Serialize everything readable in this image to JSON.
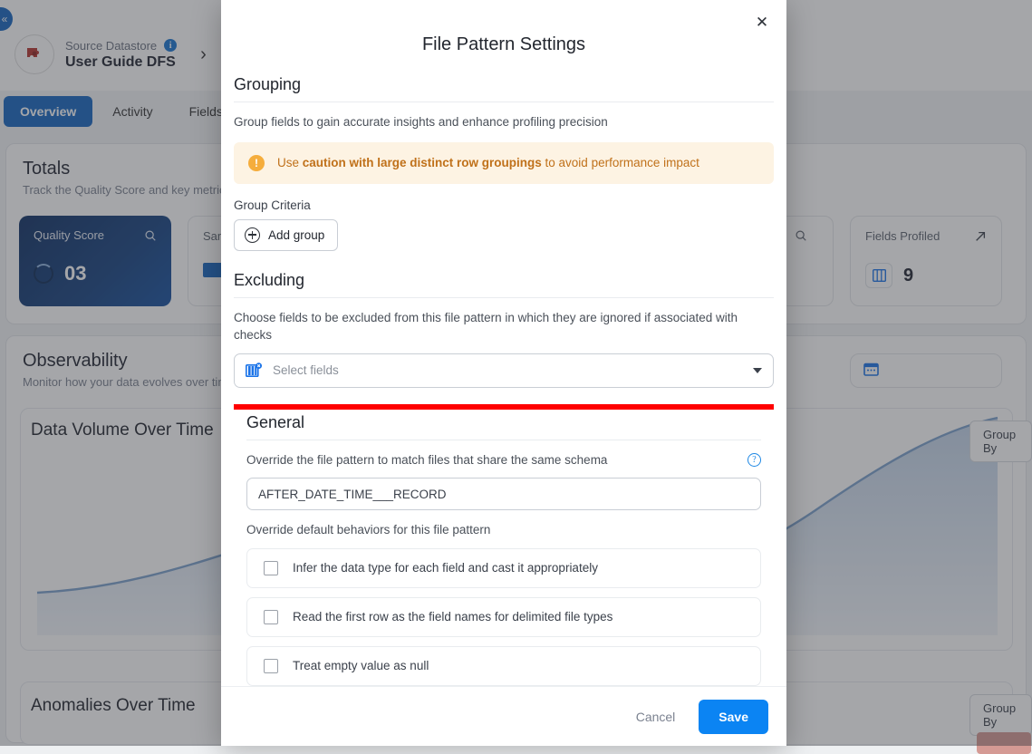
{
  "background": {
    "collapse_label": "«",
    "datastore_kicker": "Source Datastore",
    "datastore_name": "User Guide DFS",
    "info_badge": "i",
    "chevron": "›",
    "tabs": [
      {
        "label": "Overview",
        "active": true
      },
      {
        "label": "Activity",
        "active": false
      },
      {
        "label": "Fields",
        "active": false
      }
    ],
    "totals": {
      "title": "Totals",
      "subtitle": "Track the Quality Score and key metrics",
      "cards": [
        {
          "label": "Quality Score",
          "value": "03",
          "icon": "search-icon"
        },
        {
          "label": "Sam",
          "value": "",
          "icon": "search-icon"
        },
        {
          "label": "Fields Profiled",
          "value": "9",
          "icon": "arrow-up-right-icon"
        }
      ]
    },
    "observability": {
      "title": "Observability",
      "subtitle": "Monitor how your data evolves over time",
      "charts": [
        {
          "title": "Data Volume Over Time",
          "group_by": "Group By"
        },
        {
          "title": "Anomalies Over Time",
          "group_by": "Group By"
        }
      ]
    }
  },
  "modal": {
    "title": "File Pattern Settings",
    "close_label": "✕",
    "grouping": {
      "heading": "Grouping",
      "description": "Group fields to gain accurate insights and enhance profiling precision",
      "warning": {
        "prefix": "Use ",
        "strong": "caution with large distinct row groupings",
        "suffix": " to avoid performance impact"
      },
      "group_criteria_label": "Group Criteria",
      "add_group_label": "Add group"
    },
    "excluding": {
      "heading": "Excluding",
      "description": "Choose fields to be excluded from this file pattern in which they are ignored if associated with checks",
      "select_placeholder": "Select fields"
    },
    "general": {
      "heading": "General",
      "override_label": "Override the file pattern to match files that share the same schema",
      "help_badge": "?",
      "pattern_value": "AFTER_DATE_TIME___RECORD",
      "behaviors_label": "Override default behaviors for this file pattern",
      "behaviors": [
        {
          "label": "Infer the data type for each field and cast it appropriately",
          "checked": false
        },
        {
          "label": "Read the first row as the field names for delimited file types",
          "checked": false
        },
        {
          "label": "Treat empty value as null",
          "checked": false
        }
      ]
    },
    "footer": {
      "cancel_label": "Cancel",
      "save_label": "Save"
    }
  },
  "colors": {
    "accent_blue": "#0b84f3",
    "primary_blue": "#1565c0",
    "warning_orange": "#c0711a",
    "warning_bg": "#fdf3e3",
    "highlight_red": "#ff0000"
  }
}
